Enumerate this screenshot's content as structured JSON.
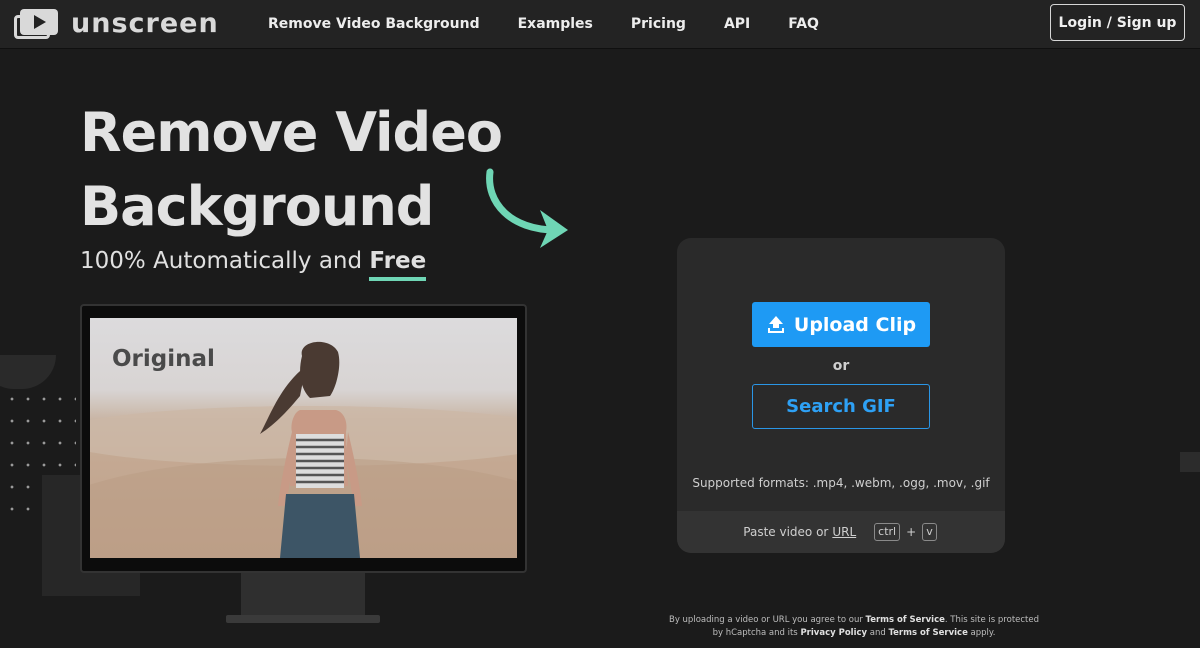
{
  "nav": {
    "logo_text": "unscreen",
    "links": [
      "Remove Video Background",
      "Examples",
      "Pricing",
      "API",
      "FAQ"
    ],
    "login_label": "Login / Sign up"
  },
  "hero": {
    "title_line1": "Remove Video",
    "title_line2": "Background",
    "subtitle_prefix": "100% Automatically and ",
    "subtitle_free": "Free",
    "accent_color": "#6fd6b5"
  },
  "preview": {
    "label": "Original"
  },
  "upload": {
    "upload_label": "Upload Clip",
    "or_text": "or",
    "search_label": "Search GIF",
    "formats_text": "Supported formats: .mp4, .webm, .ogg, .mov, .gif",
    "paste_prefix": "Paste video or",
    "paste_url": "URL",
    "key_ctrl": "ctrl",
    "key_plus": "+",
    "key_v": "v",
    "primary_color": "#1e9af4"
  },
  "legal": {
    "t1": "By uploading a video or URL you agree to our ",
    "tos1": "Terms of Service",
    "t2": ". This site is protected by hCaptcha and its ",
    "privacy": "Privacy Policy",
    "t3": " and ",
    "tos2": "Terms of Service",
    "t4": " apply."
  }
}
